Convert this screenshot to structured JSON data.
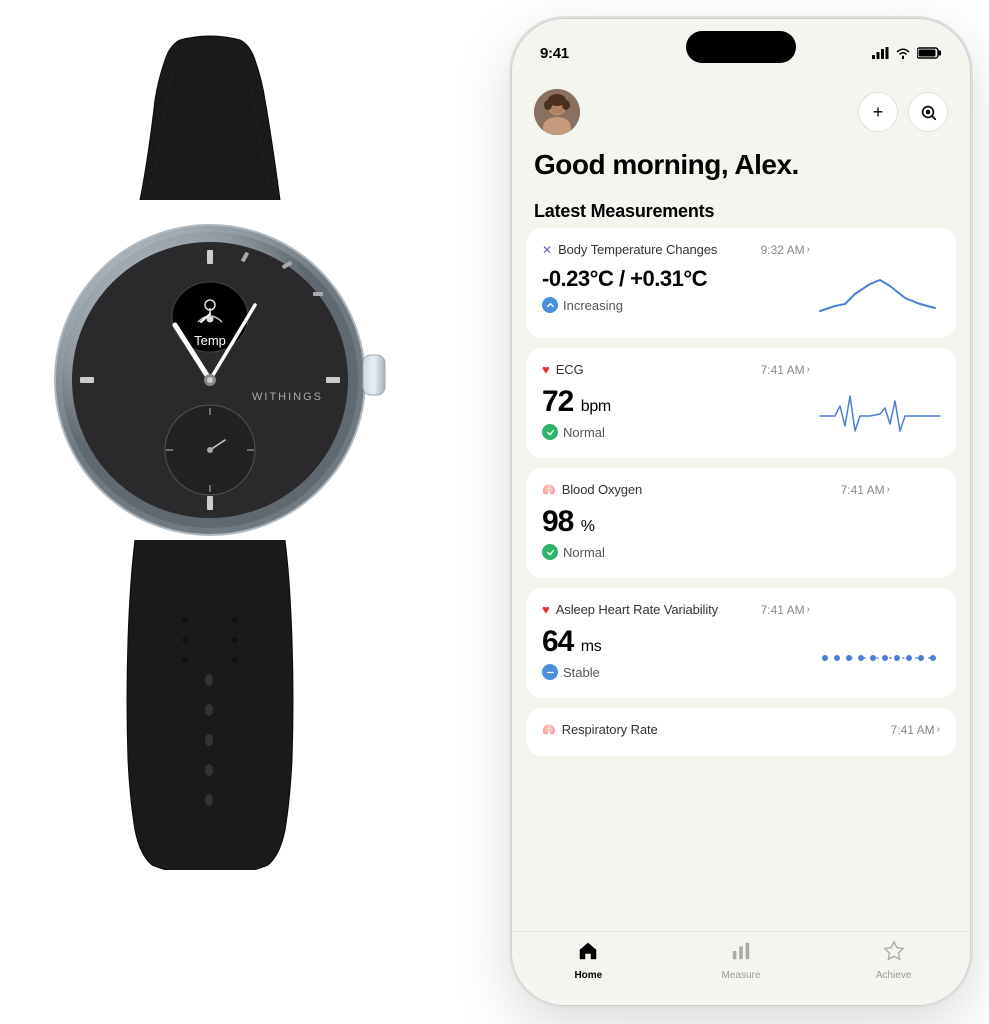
{
  "page": {
    "background": "#ffffff"
  },
  "phone": {
    "status_bar": {
      "time": "9:41",
      "signal_icon": "signal-icon",
      "wifi_icon": "wifi-icon",
      "battery_icon": "battery-icon"
    },
    "header": {
      "greeting": "Good morning, Alex.",
      "add_button_label": "+",
      "scan_button_label": "⊙"
    },
    "section_title": "Latest Measurements",
    "measurements": [
      {
        "id": "body-temp",
        "icon": "✕",
        "icon_color": "#6a5acd",
        "title": "Body Temperature Changes",
        "time": "9:32 AM",
        "value": "-0.23°C / +0.31°C",
        "value_unit": "",
        "status": "Increasing",
        "status_type": "blue",
        "has_chart": true,
        "chart_type": "temperature"
      },
      {
        "id": "ecg",
        "icon": "♥",
        "icon_color": "#e53935",
        "title": "ECG",
        "time": "7:41 AM",
        "value": "72",
        "value_unit": "bpm",
        "status": "Normal",
        "status_type": "green",
        "has_chart": true,
        "chart_type": "ecg"
      },
      {
        "id": "blood-oxygen",
        "icon": "🫁",
        "icon_color": "#42a5c8",
        "title": "Blood Oxygen",
        "time": "7:41 AM",
        "value": "98",
        "value_unit": "%",
        "status": "Normal",
        "status_type": "green",
        "has_chart": false,
        "chart_type": ""
      },
      {
        "id": "hrv",
        "icon": "♥",
        "icon_color": "#e53935",
        "title": "Asleep Heart Rate Variability",
        "time": "7:41 AM",
        "value": "64",
        "value_unit": "ms",
        "status": "Stable",
        "status_type": "blue",
        "has_chart": true,
        "chart_type": "hrv"
      },
      {
        "id": "respiratory",
        "icon": "🫁",
        "icon_color": "#42a5c8",
        "title": "Respiratory Rate",
        "time": "7:41 AM",
        "value": "",
        "value_unit": "",
        "status": "",
        "status_type": "",
        "has_chart": false,
        "chart_type": ""
      }
    ],
    "nav": {
      "items": [
        {
          "id": "home",
          "label": "Home",
          "icon": "⌂",
          "active": true
        },
        {
          "id": "measure",
          "label": "Measure",
          "icon": "📊",
          "active": false
        },
        {
          "id": "achieve",
          "label": "Achieve",
          "icon": "★",
          "active": false
        }
      ]
    }
  },
  "watch": {
    "brand": "WITHINGS",
    "display_label": "Temp"
  }
}
